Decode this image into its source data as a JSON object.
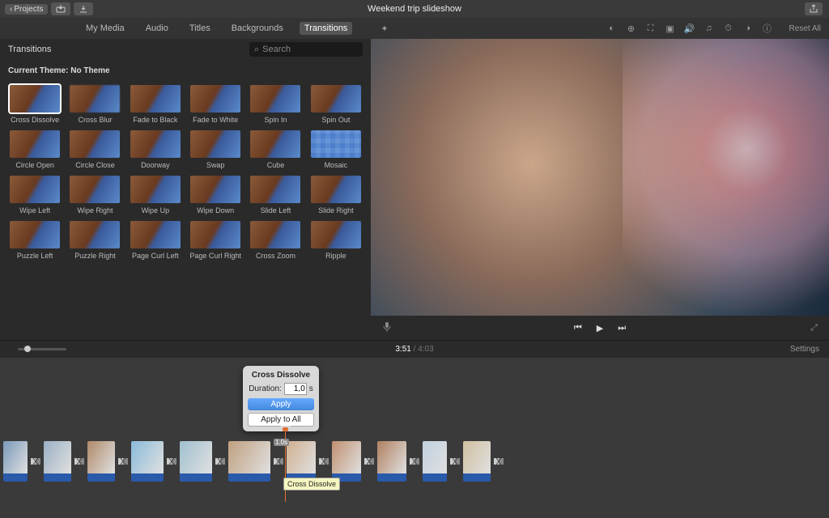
{
  "titlebar": {
    "back_label": "Projects",
    "title": "Weekend trip slideshow"
  },
  "tabs": {
    "items": [
      "My Media",
      "Audio",
      "Titles",
      "Backgrounds",
      "Transitions"
    ],
    "active_index": 4
  },
  "browser": {
    "header": "Transitions",
    "search_placeholder": "Search",
    "theme_label": "Current Theme: No Theme",
    "transitions": [
      {
        "label": "Cross Dissolve"
      },
      {
        "label": "Cross Blur"
      },
      {
        "label": "Fade to Black"
      },
      {
        "label": "Fade to White"
      },
      {
        "label": "Spin In"
      },
      {
        "label": "Spin Out"
      },
      {
        "label": "Circle Open"
      },
      {
        "label": "Circle Close"
      },
      {
        "label": "Doorway"
      },
      {
        "label": "Swap"
      },
      {
        "label": "Cube"
      },
      {
        "label": "Mosaic"
      },
      {
        "label": "Wipe Left"
      },
      {
        "label": "Wipe Right"
      },
      {
        "label": "Wipe Up"
      },
      {
        "label": "Wipe Down"
      },
      {
        "label": "Slide Left"
      },
      {
        "label": "Slide Right"
      },
      {
        "label": "Puzzle Left"
      },
      {
        "label": "Puzzle Right"
      },
      {
        "label": "Page Curl Left"
      },
      {
        "label": "Page Curl Right"
      },
      {
        "label": "Cross Zoom"
      },
      {
        "label": "Ripple"
      }
    ],
    "selected_index": 0
  },
  "viewer_toolbar": {
    "reset_label": "Reset All"
  },
  "playback": {
    "current_time": "3:51",
    "total_time": "4:03",
    "settings_label": "Settings"
  },
  "popover": {
    "title": "Cross Dissolve",
    "duration_label": "Duration:",
    "duration_value": "1,0",
    "duration_unit": "s",
    "apply_label": "Apply",
    "apply_all_label": "Apply to All"
  },
  "timeline": {
    "clip_tooltip": "Cross Dissolve",
    "selected_duration_badge": "1.0s",
    "clip_widths": [
      30,
      34,
      34,
      40,
      40,
      52,
      36,
      36,
      36,
      30,
      34
    ]
  }
}
